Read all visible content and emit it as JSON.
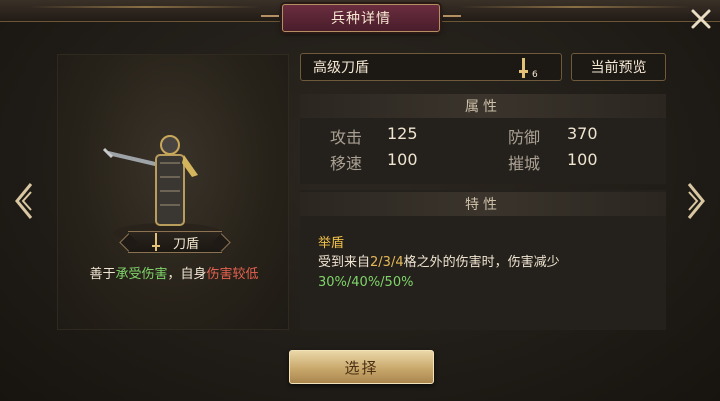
{
  "window": {
    "title": "兵种详情",
    "close_icon": "close-icon"
  },
  "nav": {
    "prev_icon": "chevron-left-icon",
    "next_icon": "chevron-right-icon"
  },
  "unit": {
    "name": "刀盾",
    "icon": "sword-tier-icon",
    "desc_prefix": "善于",
    "desc_strength": "承受伤害",
    "desc_middle": "，自身",
    "desc_weakness": "伤害较低"
  },
  "selector": {
    "value": "高级刀盾",
    "tier": "6",
    "preview_label": "当前预览"
  },
  "attributes": {
    "title": "属性",
    "items": [
      {
        "label": "攻击",
        "value": "125"
      },
      {
        "label": "防御",
        "value": "370"
      },
      {
        "label": "移速",
        "value": "100"
      },
      {
        "label": "摧城",
        "value": "100"
      }
    ]
  },
  "traits": {
    "title": "特性",
    "name": "举盾",
    "desc_a": "受到来自",
    "desc_ranges": "2/3/4",
    "desc_b": "格之外的伤害时，伤害减少",
    "desc_values": "30%/40%/50%"
  },
  "actions": {
    "select_label": "选择"
  },
  "colors": {
    "accent_gold": "#c9a86c",
    "title_plate": "#5a2535",
    "positive": "#7fd46a",
    "negative": "#e6614f",
    "trait_name": "#f1c24a"
  }
}
